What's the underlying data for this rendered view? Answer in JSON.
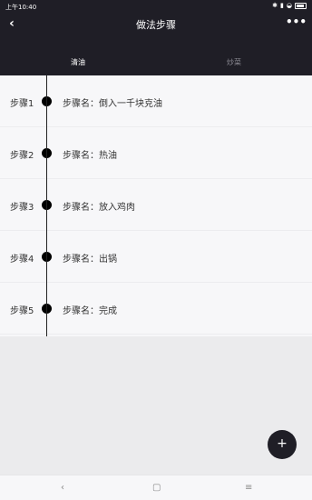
{
  "status": {
    "time": "上午10:40",
    "icons": [
      "bluetooth-icon",
      "signal-icon",
      "wifi-icon",
      "battery-icon"
    ]
  },
  "nav": {
    "back_icon": "‹",
    "title": "做法步骤",
    "more_icon": "•••"
  },
  "tabs": [
    {
      "label": "清油"
    },
    {
      "label": "炒菜"
    }
  ],
  "steps": [
    {
      "step": "步骤1",
      "name": "步骤名：倒入一千块克油"
    },
    {
      "step": "步骤2",
      "name": "步骤名：热油"
    },
    {
      "step": "步骤3",
      "name": "步骤名：放入鸡肉"
    },
    {
      "step": "步骤4",
      "name": "步骤名：出锅"
    },
    {
      "step": "步骤5",
      "name": "步骤名：完成"
    }
  ],
  "fab": {
    "label": "+"
  },
  "sysnav": {
    "back": "‹",
    "home": "▢",
    "menu": "≡"
  },
  "colors": {
    "header": "#1f1e26",
    "list_bg": "#f7f7f9",
    "page_bg": "#ebebed"
  }
}
